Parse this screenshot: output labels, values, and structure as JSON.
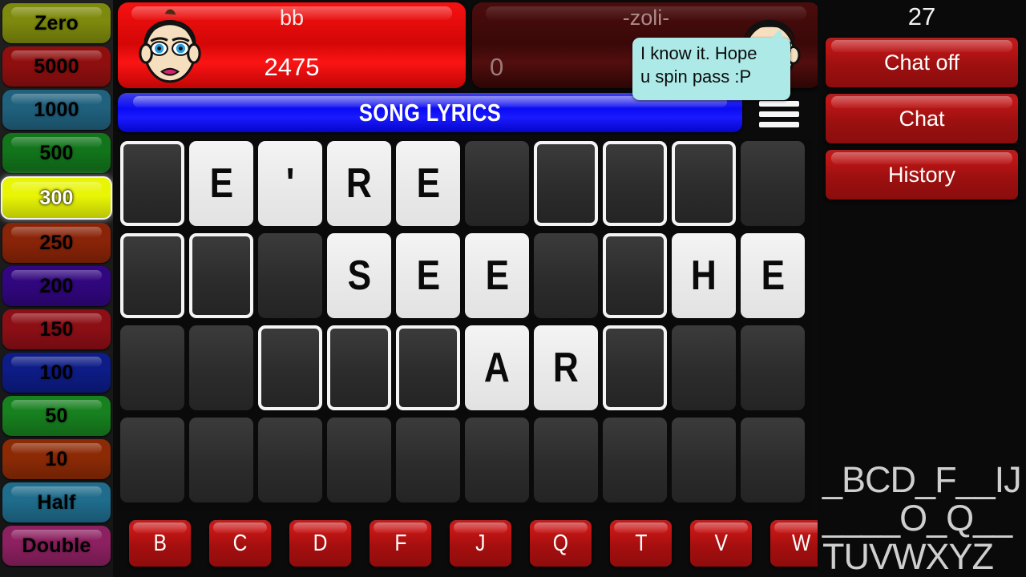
{
  "wheel": {
    "wedges": [
      {
        "label": "Zero",
        "color": "#7e8a0d",
        "text": "#000000",
        "selected": false
      },
      {
        "label": "5000",
        "color": "#8f0f0f",
        "text": "#000000",
        "selected": false
      },
      {
        "label": "1000",
        "color": "#20617e",
        "text": "#000000",
        "selected": false
      },
      {
        "label": "500",
        "color": "#12751b",
        "text": "#000000",
        "selected": false
      },
      {
        "label": "300",
        "color": "#e8f505",
        "text": "#ffffff",
        "selected": true
      },
      {
        "label": "250",
        "color": "#8a2408",
        "text": "#000000",
        "selected": false
      },
      {
        "label": "200",
        "color": "#31067e",
        "text": "#000000",
        "selected": false
      },
      {
        "label": "150",
        "color": "#8d0f16",
        "text": "#000000",
        "selected": false
      },
      {
        "label": "100",
        "color": "#0d1c86",
        "text": "#000000",
        "selected": false
      },
      {
        "label": "50",
        "color": "#17801f",
        "text": "#000000",
        "selected": false
      },
      {
        "label": "10",
        "color": "#8c2a06",
        "text": "#000000",
        "selected": false
      },
      {
        "label": "Half",
        "color": "#1f6c8c",
        "text": "#000000",
        "selected": false
      },
      {
        "label": "Double",
        "color": "#8c2060",
        "text": "#000000",
        "selected": false
      }
    ]
  },
  "players": [
    {
      "name": "bb",
      "score": "2475",
      "active": true,
      "avatar": "female-avatar"
    },
    {
      "name": "-zoli-",
      "score": "0",
      "active": false,
      "avatar": "male-avatar"
    }
  ],
  "chat_bubble": {
    "line1": "I know it. Hope",
    "line2": "u spin pass :P",
    "color": "#ace9e7"
  },
  "category": {
    "label": "SONG LYRICS",
    "color": "#1a1aff"
  },
  "menu": {
    "icon": "hamburger-menu-icon"
  },
  "board": {
    "rows": [
      [
        {
          "state": "empty-slot",
          "letter": ""
        },
        {
          "state": "letter",
          "letter": "E"
        },
        {
          "state": "letter",
          "letter": "'"
        },
        {
          "state": "letter",
          "letter": "R"
        },
        {
          "state": "letter",
          "letter": "E"
        },
        {
          "state": "blank",
          "letter": ""
        },
        {
          "state": "empty-slot",
          "letter": ""
        },
        {
          "state": "empty-slot",
          "letter": ""
        },
        {
          "state": "empty-slot",
          "letter": ""
        },
        {
          "state": "blank",
          "letter": ""
        }
      ],
      [
        {
          "state": "empty-slot",
          "letter": ""
        },
        {
          "state": "empty-slot",
          "letter": ""
        },
        {
          "state": "blank",
          "letter": ""
        },
        {
          "state": "letter",
          "letter": "S"
        },
        {
          "state": "letter",
          "letter": "E"
        },
        {
          "state": "letter",
          "letter": "E"
        },
        {
          "state": "blank",
          "letter": ""
        },
        {
          "state": "empty-slot",
          "letter": ""
        },
        {
          "state": "letter",
          "letter": "H"
        },
        {
          "state": "letter",
          "letter": "E"
        }
      ],
      [
        {
          "state": "blank",
          "letter": ""
        },
        {
          "state": "blank",
          "letter": ""
        },
        {
          "state": "empty-slot",
          "letter": ""
        },
        {
          "state": "empty-slot",
          "letter": ""
        },
        {
          "state": "empty-slot",
          "letter": ""
        },
        {
          "state": "letter",
          "letter": "A"
        },
        {
          "state": "letter",
          "letter": "R"
        },
        {
          "state": "empty-slot",
          "letter": ""
        },
        {
          "state": "blank",
          "letter": ""
        },
        {
          "state": "blank",
          "letter": ""
        }
      ],
      [
        {
          "state": "blank",
          "letter": ""
        },
        {
          "state": "blank",
          "letter": ""
        },
        {
          "state": "blank",
          "letter": ""
        },
        {
          "state": "blank",
          "letter": ""
        },
        {
          "state": "blank",
          "letter": ""
        },
        {
          "state": "blank",
          "letter": ""
        },
        {
          "state": "blank",
          "letter": ""
        },
        {
          "state": "blank",
          "letter": ""
        },
        {
          "state": "blank",
          "letter": ""
        },
        {
          "state": "blank",
          "letter": ""
        }
      ]
    ]
  },
  "letter_buttons": [
    "B",
    "C",
    "D",
    "F",
    "J",
    "Q",
    "T",
    "V",
    "W"
  ],
  "right_panel": {
    "timer": "27",
    "buttons": [
      "Chat off",
      "Chat",
      "History"
    ],
    "remaining_letters": "_BCD_F__IJ____O_Q__TUVWXYZ"
  }
}
